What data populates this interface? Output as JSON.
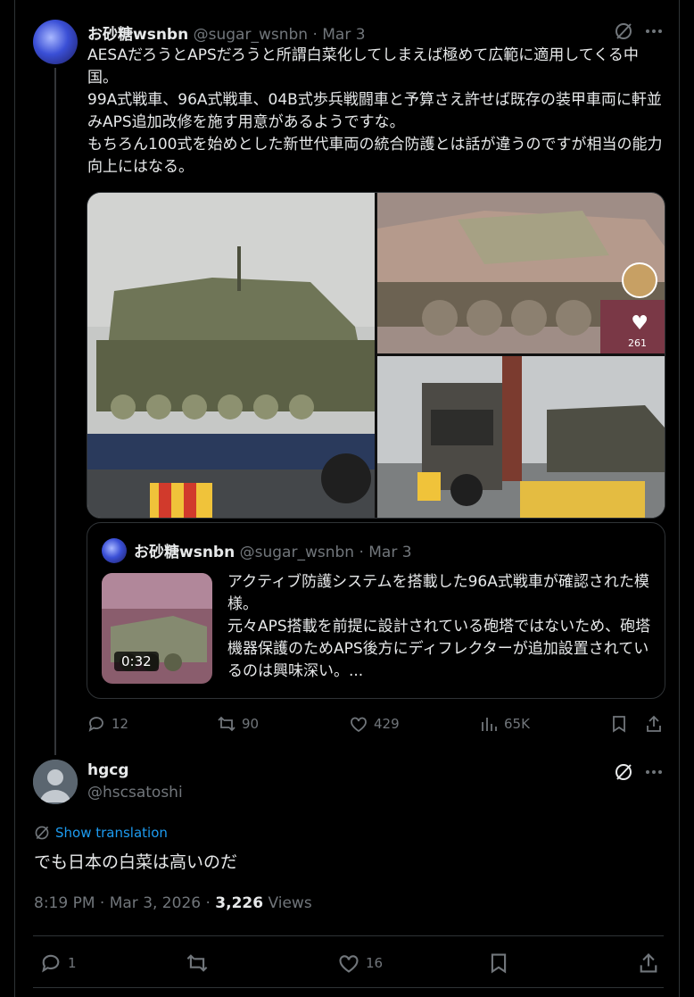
{
  "tweet": {
    "display_name": "お砂糖wsnbn",
    "handle": "@sugar_wsnbn",
    "date": "Mar 3",
    "lines": [
      "AESAだろうとAPSだろうと所謂白菜化してしまえば極めて広範に適用してくる中国。",
      "99A式戦車、96A式戦車、04B式歩兵戦闘車と予算さえ許せば既存の装甲車両に軒並みAPS追加改修を施す用意があるようですな。",
      "もちろん100式を始めとした新世代車両の統合防護とは話が違うのですが相当の能力向上にはなる。"
    ],
    "image_overlay": {
      "likes": "261"
    },
    "quote": {
      "display_name": "お砂糖wsnbn",
      "handle": "@sugar_wsnbn",
      "date": "Mar 3",
      "video_duration": "0:32",
      "lines": [
        "アクティブ防護システムを搭載した96A式戦車が確認された模様。",
        "元々APS搭載を前提に設計されている砲塔ではないため、砲塔機器保護のためAPS後方にディフレクターが追加設置されているのは興味深い。..."
      ]
    },
    "stats": {
      "replies": "12",
      "reposts": "90",
      "likes": "429",
      "views": "65K"
    }
  },
  "reply": {
    "display_name": "hgcg",
    "handle": "@hscsatoshi",
    "translate_label": "Show translation",
    "text": "でも日本の白菜は高いのだ",
    "time": "8:19 PM · Mar 3, 2026 · ",
    "views_count": "3,226",
    "views_label": " Views",
    "stats": {
      "replies": "1",
      "reposts": "",
      "likes": "16"
    }
  },
  "icons": {
    "grok": "grok-icon",
    "more": "more-icon",
    "reply": "reply-icon",
    "repost": "repost-icon",
    "like": "heart-icon",
    "views": "views-icon",
    "bookmark": "bookmark-icon",
    "share": "share-icon",
    "translate": "translate-icon"
  },
  "colors": {
    "background": "#000000",
    "text": "#e7e9ea",
    "muted": "#71767b",
    "link": "#1d9bf0",
    "border": "#2f3336"
  }
}
